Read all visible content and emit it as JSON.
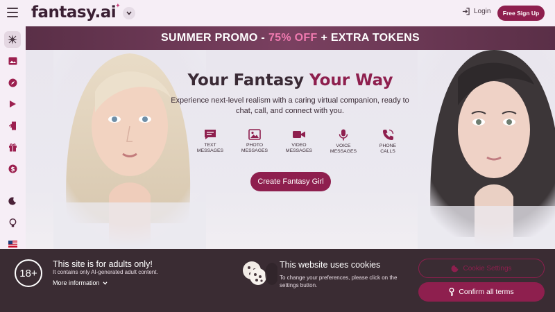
{
  "header": {
    "logo_text": "fantasy.ai",
    "login_label": "Login",
    "signup_label": "Free Sign Up"
  },
  "sidebar": {
    "items": [
      {
        "icon": "sparkle-icon",
        "active": true
      },
      {
        "icon": "gallery-icon",
        "active": false
      },
      {
        "icon": "compass-icon",
        "active": false
      },
      {
        "icon": "play-icon",
        "active": false
      },
      {
        "icon": "door-icon",
        "active": false
      },
      {
        "icon": "gift-icon",
        "active": false
      },
      {
        "icon": "dollar-icon",
        "active": false
      },
      {
        "icon": "moon-icon",
        "active": false
      },
      {
        "icon": "bulb-icon",
        "active": false
      },
      {
        "icon": "us-flag-icon",
        "active": false
      }
    ]
  },
  "promo": {
    "part1": "SUMMER PROMO -",
    "highlight": "75% OFF",
    "part2": "+ EXTRA TOKENS"
  },
  "hero": {
    "title_part1": "Your Fantasy",
    "title_accent": "Your Way",
    "subtitle": "Experience next-level realism with a caring virtual companion, ready to chat, call, and connect with you.",
    "features": [
      {
        "icon": "chat-icon",
        "line1": "TEXT",
        "line2": "MESSAGES"
      },
      {
        "icon": "photo-icon",
        "line1": "PHOTO",
        "line2": "MESSAGES"
      },
      {
        "icon": "video-icon",
        "line1": "VIDEO",
        "line2": "MESSAGES"
      },
      {
        "icon": "microphone-icon",
        "line1": "VOICE",
        "line2": "MESSAGES"
      },
      {
        "icon": "phone-icon",
        "line1": "PHONE",
        "line2": "CALLS"
      }
    ],
    "cta_label": "Create Fantasy Girl"
  },
  "adult_notice": {
    "badge": "18+",
    "title": "This site is for adults only!",
    "note": "It contains only AI-generated adult content.",
    "more_label": "More information"
  },
  "cookies": {
    "title": "This website uses cookies",
    "note": "To change your preferences, please click on the settings button.",
    "settings_label": "Cookie Settings",
    "confirm_label": "Confirm all terms"
  },
  "colors": {
    "brand": "#8e1f4e",
    "promo_highlight": "#f07ab0",
    "footer_bg": "#3a2c33"
  }
}
